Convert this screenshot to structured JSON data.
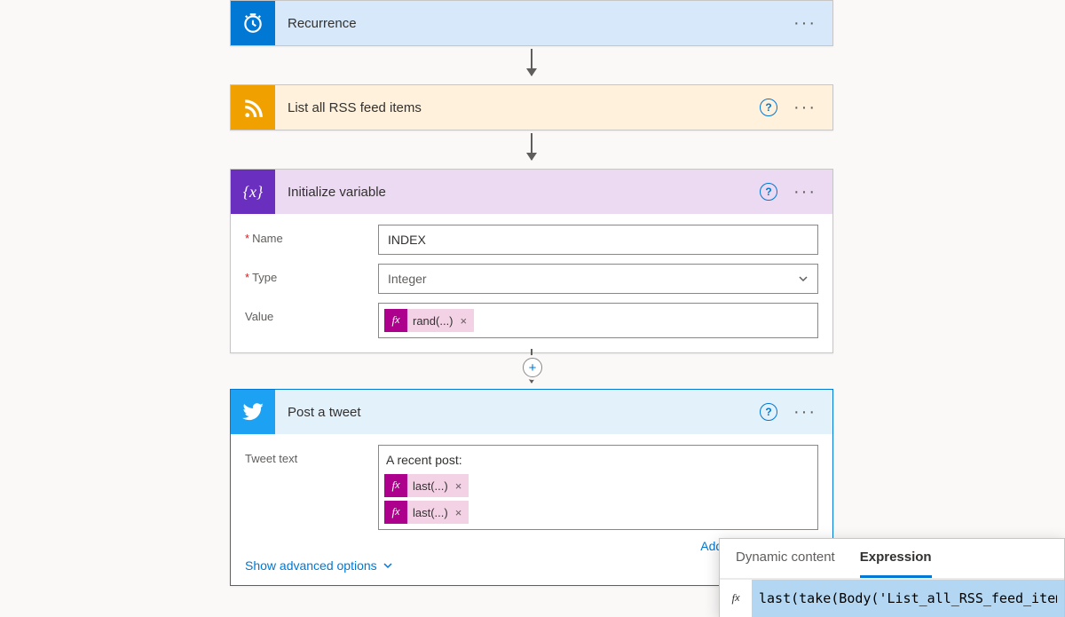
{
  "steps": {
    "recurrence": {
      "title": "Recurrence",
      "color": "#0078d4",
      "bg": "#d6e8fa"
    },
    "rss": {
      "title": "List all RSS feed items",
      "color": "#f0a100",
      "bg": "#fff1db",
      "help": "?"
    },
    "init": {
      "title": "Initialize variable",
      "color": "#6b2fbf",
      "bg": "#ecd9f2",
      "help": "?",
      "fields": {
        "name": {
          "label": "Name",
          "value": "INDEX"
        },
        "type": {
          "label": "Type",
          "value": "Integer"
        },
        "value": {
          "label": "Value",
          "token": "rand(...)"
        }
      }
    },
    "tweet": {
      "title": "Post a tweet",
      "color": "#1da1f2",
      "bg": "#e3f1fb",
      "help": "?",
      "fields": {
        "text": {
          "label": "Tweet text",
          "pretext": "A recent post:",
          "tok1": "last(...)",
          "tok2": "last(...)"
        }
      },
      "add": "Add dynamic content",
      "adv": "Show advanced options"
    }
  },
  "popup": {
    "tab1": "Dynamic content",
    "tab2": "Expression",
    "expr": "last(take(Body('List_all_RSS_feed_item"
  }
}
